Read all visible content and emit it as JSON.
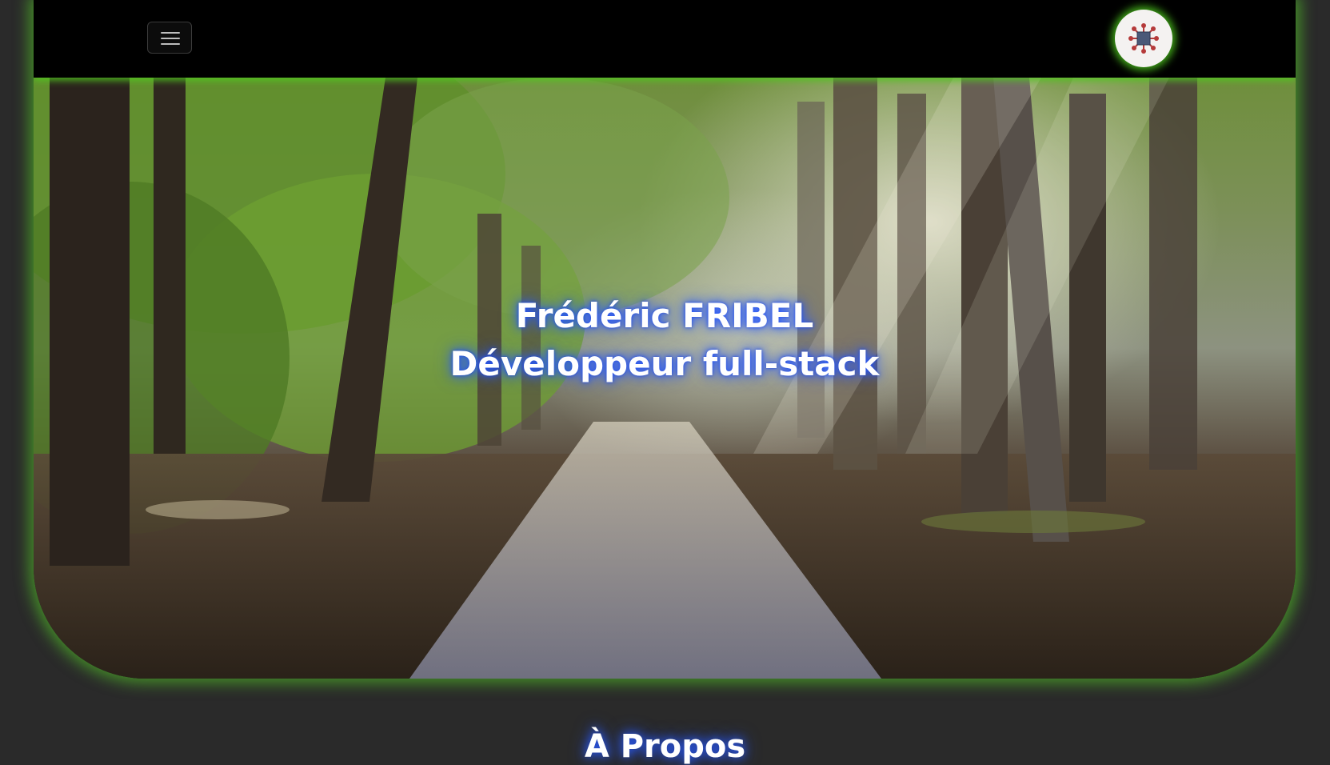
{
  "navbar": {
    "menu_toggle_icon": "hamburger-menu-icon",
    "logo_icon": "network-nodes-logo-icon"
  },
  "hero": {
    "name": "Frédéric FRIBEL",
    "role": "Développeur full-stack",
    "background": "forest-path-photo"
  },
  "section": {
    "heading": "À Propos"
  },
  "colors": {
    "glow_green": "#5adc28",
    "text_glow_blue": "#285aff",
    "page_background": "#2a2a2a",
    "navbar_background": "#000000"
  }
}
